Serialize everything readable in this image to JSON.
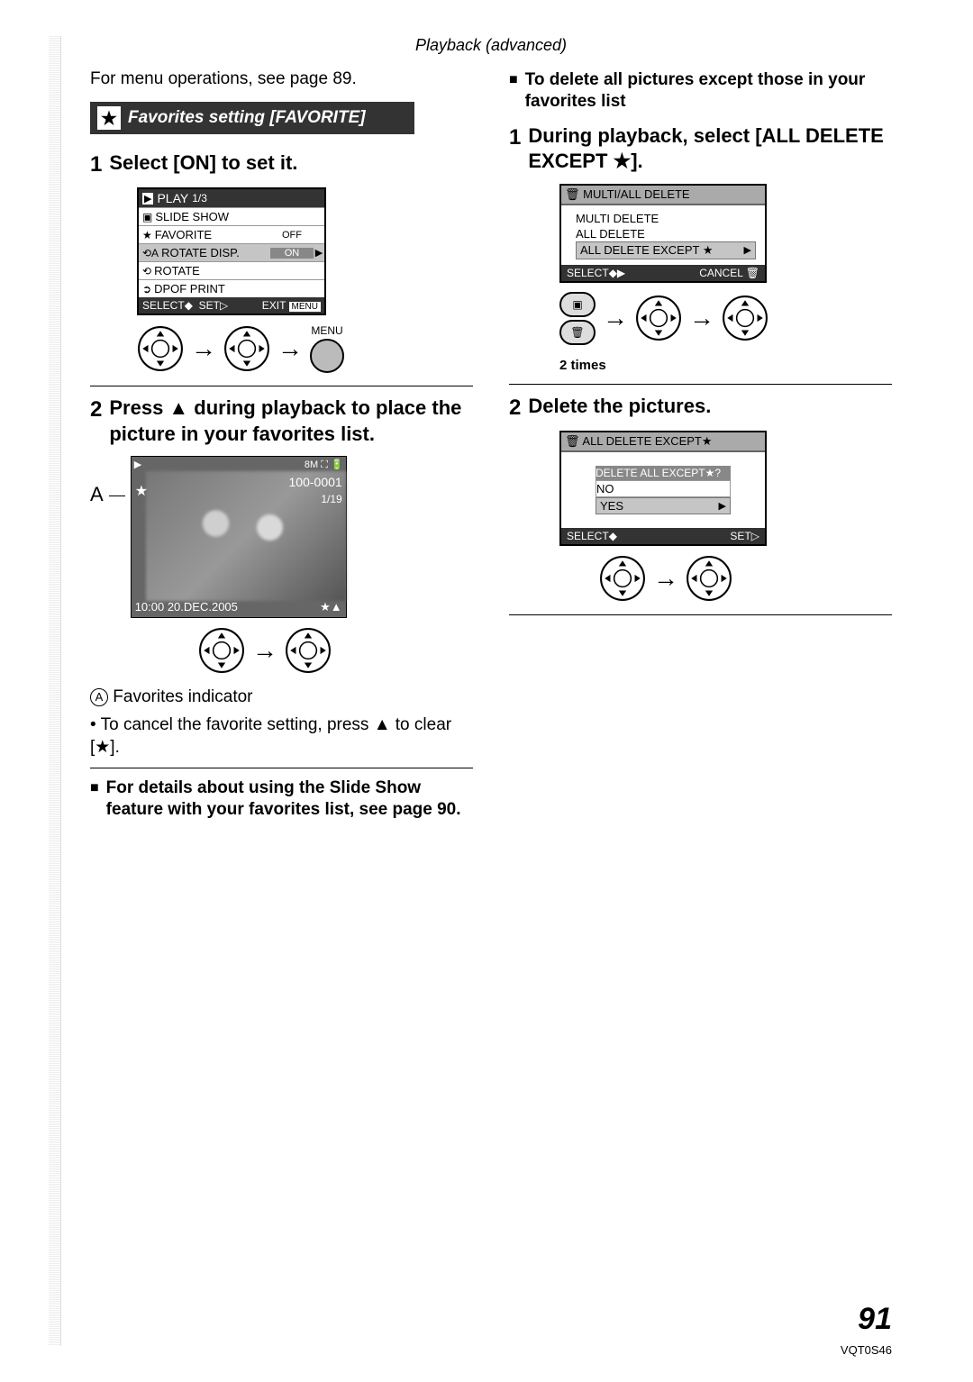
{
  "header": {
    "section": "Playback (advanced)"
  },
  "left": {
    "intro": "For menu operations, see page 89.",
    "banner": "Favorites setting [FAVORITE]",
    "step1": {
      "num": "1",
      "text": "Select [ON] to set it."
    },
    "menu": {
      "title": "PLAY",
      "fraction": "1/3",
      "rows": [
        {
          "label": "SLIDE SHOW",
          "icon": "▣"
        },
        {
          "label": "FAVORITE",
          "icon": "★",
          "val": "OFF"
        },
        {
          "label": "ROTATE DISP.",
          "icon": "⟲A",
          "val": "ON",
          "hl": true,
          "arrow": "▶"
        },
        {
          "label": "ROTATE",
          "icon": "⟲"
        },
        {
          "label": "DPOF PRINT",
          "icon": "➲"
        }
      ],
      "footer": {
        "select": "SELECT",
        "set": "SET",
        "exit": "EXIT",
        "menu": "MENU"
      }
    },
    "menu_btn_label": "MENU",
    "step2": {
      "num": "2",
      "text": "Press ▲ during playback to place the picture in your favorites list."
    },
    "photo": {
      "size": "8M",
      "fileno": "100-0001",
      "count": "1/19",
      "datetime": "10:00  20.DEC.2005",
      "label": "A"
    },
    "note_a": "Favorites indicator",
    "note_cancel": "To cancel the favorite setting, press ▲ to clear [★].",
    "subhead": "For details about using the Slide Show feature with your favorites list, see page 90."
  },
  "right": {
    "subhead": "To delete all pictures except those in your favorites list",
    "step1": {
      "num": "1",
      "text": "During playback, select [ALL DELETE EXCEPT ★]."
    },
    "menu": {
      "title": "MULTI/ALL DELETE",
      "rows": [
        "MULTI DELETE",
        "ALL DELETE"
      ],
      "sel": "ALL DELETE EXCEPT ★",
      "footer": {
        "select": "SELECT",
        "cancel": "CANCEL"
      }
    },
    "two_times": "2 times",
    "step2": {
      "num": "2",
      "text": "Delete the pictures."
    },
    "confirm": {
      "title": "ALL DELETE EXCEPT★",
      "question": "DELETE ALL EXCEPT★?",
      "no": "NO",
      "yes": "YES",
      "footer": {
        "select": "SELECT",
        "set": "SET"
      }
    }
  },
  "footer": {
    "page": "91",
    "code": "VQT0S46"
  }
}
